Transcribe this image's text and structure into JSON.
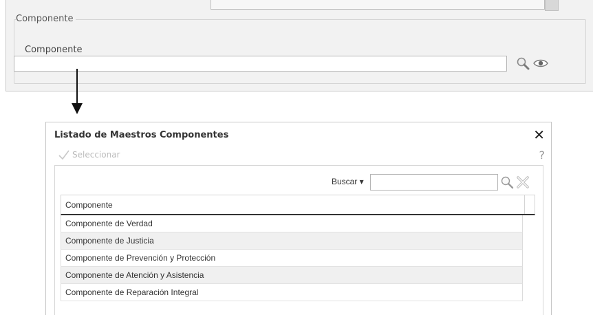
{
  "form": {
    "fieldset_legend": "Componente",
    "field_label": "Componente",
    "field_value": ""
  },
  "dialog": {
    "title": "Listado de Maestros Componentes",
    "close_glyph": "✕",
    "select_label": "Seleccionar",
    "help_glyph": "?",
    "search_label": "Buscar ▾",
    "search_value": "",
    "column_header": "Componente",
    "rows": [
      "Componente de Verdad",
      "Componente de Justicia",
      "Componente de Prevención y Protección",
      "Componente de Atención y Asistencia",
      "Componente de Reparación Integral"
    ]
  },
  "icons": {
    "field_search": "magnifier-icon",
    "field_view": "eye-icon",
    "select": "checkmark-icon",
    "search_go": "magnifier-icon",
    "search_clear": "clear-x-icon",
    "close": "close-icon",
    "help": "help-icon"
  }
}
